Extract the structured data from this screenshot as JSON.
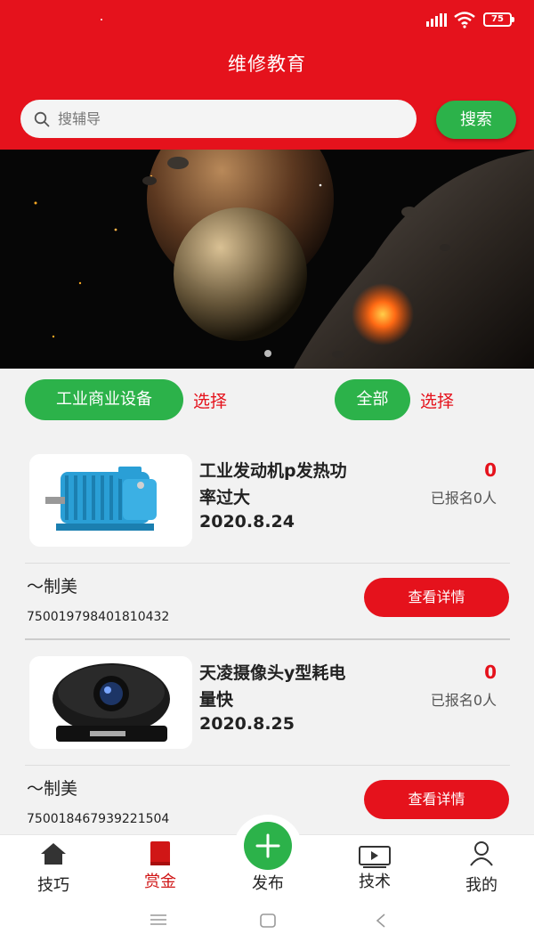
{
  "status_bar": {
    "battery": "75"
  },
  "header": {
    "title": "维修教育",
    "search_placeholder": "搜辅导",
    "search_button": "搜索"
  },
  "filters": {
    "category_label": "工业商业设备",
    "category_select": "选择",
    "scope_label": "全部",
    "scope_select": "选择"
  },
  "cards": [
    {
      "title": "工业发动机p发热功率过大",
      "date": "2020.8.24",
      "reward": "0",
      "signups": "已报名0人",
      "author": "〜制美",
      "order_id": "750019798401810432",
      "detail_button": "查看详情"
    },
    {
      "title": "天凌摄像头y型耗电量快",
      "date": "2020.8.25",
      "reward": "0",
      "signups": "已报名0人",
      "author": "〜制美",
      "order_id": "750018467939221504",
      "detail_button": "查看详情"
    }
  ],
  "bottom_nav": {
    "items": [
      {
        "label": "技巧",
        "icon": "home-icon",
        "active": false
      },
      {
        "label": "赏金",
        "icon": "book-icon",
        "active": true
      },
      {
        "label": "发布",
        "icon": "plus-icon",
        "active": false
      },
      {
        "label": "技术",
        "icon": "video-icon",
        "active": false
      },
      {
        "label": "我的",
        "icon": "user-icon",
        "active": false
      }
    ]
  },
  "colors": {
    "brand_red": "#e5121c",
    "accent_green": "#2cb24a",
    "background": "#f2f2f2"
  }
}
